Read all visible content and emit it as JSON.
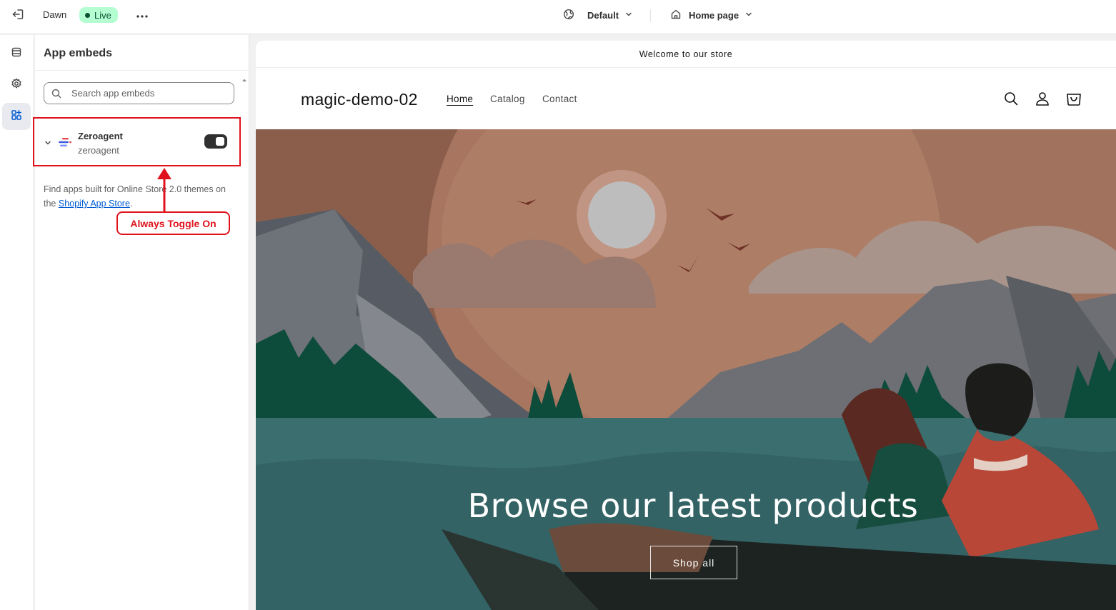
{
  "topbar": {
    "theme_name": "Dawn",
    "status": "Live",
    "view_selector": "Default",
    "page_selector": "Home page"
  },
  "rail": {
    "items": [
      "sections-icon",
      "settings-icon",
      "app-embeds-icon"
    ],
    "active": "app-embeds-icon"
  },
  "sidebar": {
    "title": "App embeds",
    "search_placeholder": "Search app embeds",
    "app": {
      "name": "Zeroagent",
      "subtitle": "zeroagent",
      "enabled": true
    },
    "help_text_prefix": "Find apps built for Online Store 2.0 themes on the ",
    "help_link": "Shopify App Store",
    "help_text_suffix": "."
  },
  "annotation": {
    "label": "Always Toggle On",
    "color": "#e0131d"
  },
  "preview": {
    "announcement": "Welcome to our store",
    "store_name": "magic-demo-02",
    "nav": [
      "Home",
      "Catalog",
      "Contact"
    ],
    "active_nav": "Home",
    "hero_title": "Browse our latest products",
    "hero_button": "Shop all"
  }
}
